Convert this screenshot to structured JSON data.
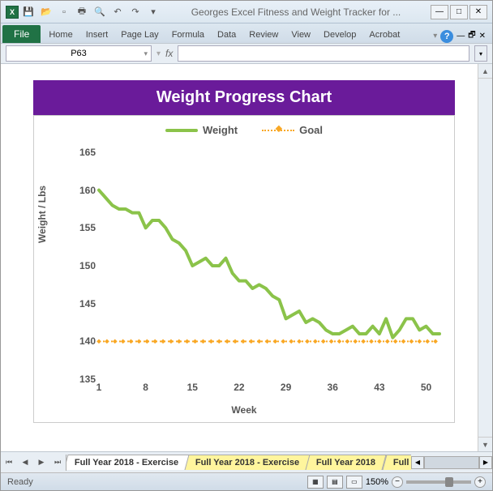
{
  "window": {
    "title": "Georges Excel Fitness and Weight Tracker for ..."
  },
  "ribbon": {
    "file": "File",
    "tabs": [
      "Home",
      "Insert",
      "Page Lay",
      "Formula",
      "Data",
      "Review",
      "View",
      "Develop",
      "Acrobat"
    ]
  },
  "namebox": {
    "cell": "P63",
    "fx": "fx"
  },
  "chart_data": {
    "type": "line",
    "title": "Weight Progress Chart",
    "xlabel": "Week",
    "ylabel": "Weight / Lbs",
    "xlim": [
      1,
      52
    ],
    "ylim": [
      135,
      165
    ],
    "x_ticks": [
      1,
      8,
      15,
      22,
      29,
      36,
      43,
      50
    ],
    "y_ticks": [
      135,
      140,
      145,
      150,
      155,
      160,
      165
    ],
    "series": [
      {
        "name": "Weight",
        "color": "#8bc34a",
        "x": [
          1,
          2,
          3,
          4,
          5,
          6,
          7,
          8,
          9,
          10,
          11,
          12,
          13,
          14,
          15,
          16,
          17,
          18,
          19,
          20,
          21,
          22,
          23,
          24,
          25,
          26,
          27,
          28,
          29,
          30,
          31,
          32,
          33,
          34,
          35,
          36,
          37,
          38,
          39,
          40,
          41,
          42,
          43,
          44,
          45,
          46,
          47,
          48,
          49,
          50,
          51,
          52
        ],
        "values": [
          160,
          159,
          158,
          157.5,
          157.5,
          157,
          157,
          155,
          156,
          156,
          155,
          153.5,
          153,
          152,
          150,
          150.5,
          151,
          150,
          150,
          151,
          149,
          148,
          148,
          147,
          147.5,
          147,
          146,
          145.5,
          143,
          143.5,
          144,
          142.5,
          143,
          142.5,
          141.5,
          141,
          141,
          141.5,
          142,
          141,
          141,
          142,
          141,
          143,
          140.5,
          141.5,
          143,
          143,
          141.5,
          142,
          141,
          141
        ]
      },
      {
        "name": "Goal",
        "color": "#f9a825",
        "style": "dotted",
        "x": [
          1,
          52
        ],
        "values": [
          140,
          140
        ]
      }
    ]
  },
  "sheets": {
    "tabs": [
      "Full Year 2018 - Exercise",
      "Full Year 2018 - Exercise",
      "Full Year 2018",
      "Full"
    ],
    "active_index": 0
  },
  "statusbar": {
    "state": "Ready",
    "zoom": "150%"
  }
}
